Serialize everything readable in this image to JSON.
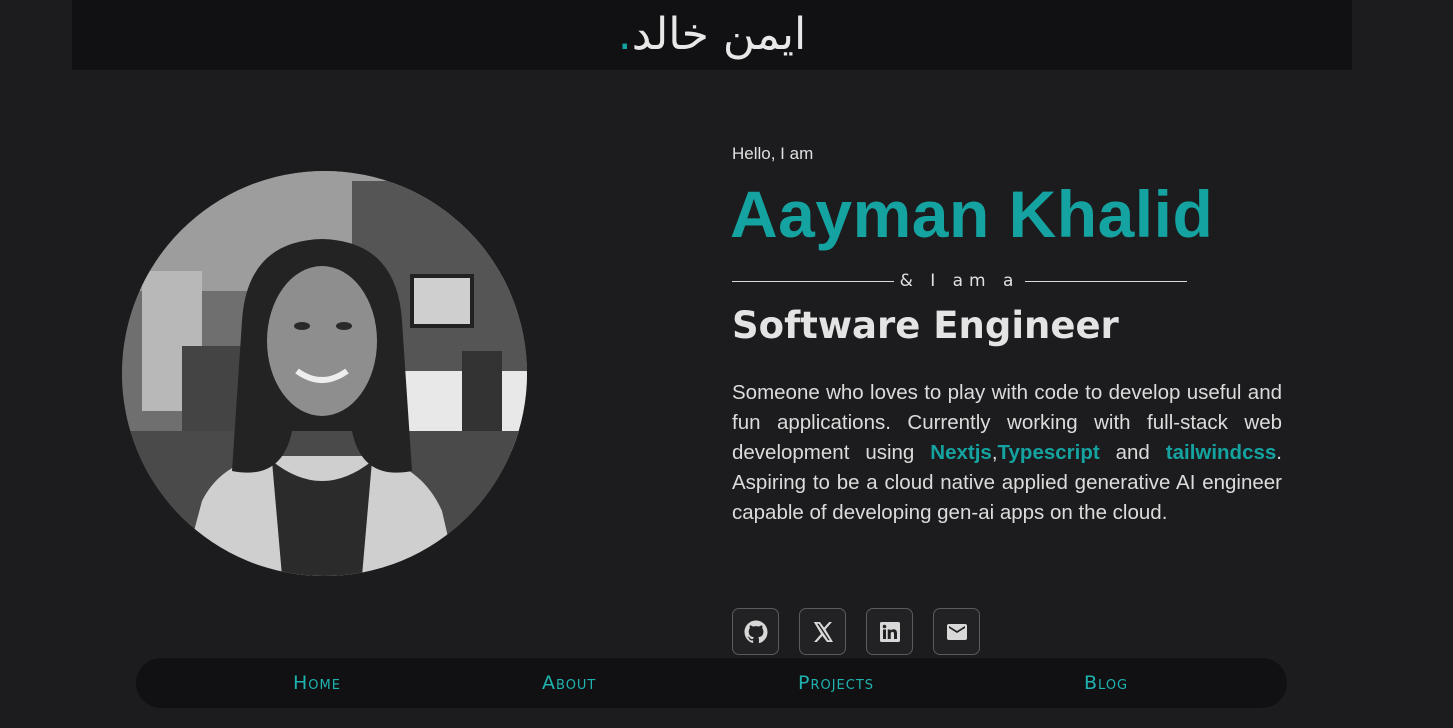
{
  "header": {
    "logo_text": "ايمن خالد",
    "logo_dot": ".",
    "accent_color": "#14a3a0"
  },
  "hero": {
    "greeting": "Hello, I am",
    "name": "Aayman Khalid",
    "divider_text": "& I am a",
    "role": "Software Engineer",
    "bio": {
      "part1": "Someone who loves to play with code to develop useful and fun applications. Currently working with full-stack web development using ",
      "tech1": "Nextjs",
      "sep": ",",
      "tech2": "Typescript",
      "and": " and ",
      "tech3": "tailwindcss",
      "part2": ". Aspiring to be a cloud native applied generative AI engineer capable of developing gen-ai apps on the cloud."
    },
    "photo_alt": "profile photo"
  },
  "socials": [
    {
      "icon": "github-icon"
    },
    {
      "icon": "x-icon"
    },
    {
      "icon": "linkedin-icon"
    },
    {
      "icon": "mail-icon"
    }
  ],
  "nav": {
    "items": [
      {
        "label": "Home"
      },
      {
        "label": "About"
      },
      {
        "label": "Projects"
      },
      {
        "label": "Blog"
      }
    ]
  }
}
